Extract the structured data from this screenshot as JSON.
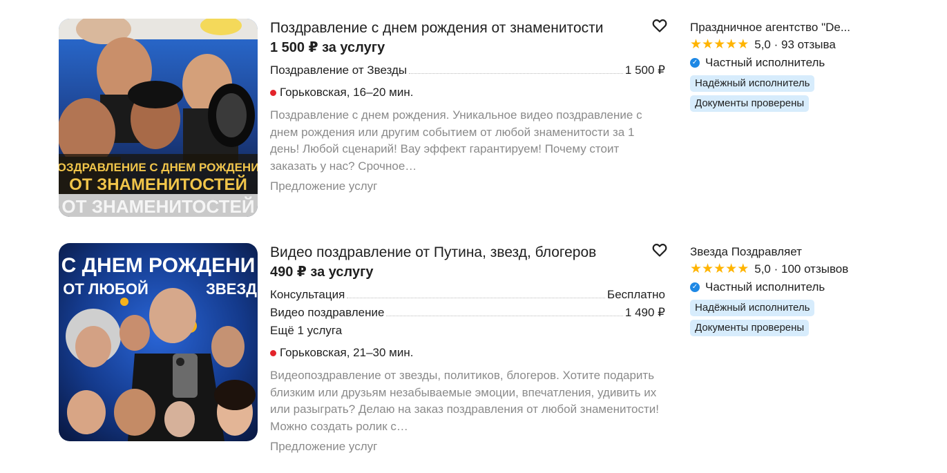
{
  "listings": [
    {
      "title": "Поздравление с днем рождения от знаменитости",
      "price": "1 500 ₽ за услугу",
      "services": [
        {
          "name": "Поздравление от Звезды",
          "price": "1 500 ₽"
        }
      ],
      "more_services": "",
      "location": "Горьковская, 16–20 мин.",
      "description": "Поздравление с днем рождения. Уникальное видео поздравление с днем рождения или другим событием от любой знаменитости за 1 день! Любой сценарий! Вау эффект гарантируем! Почему стоит заказать у нас? Срочное…",
      "category": "Предложение услуг",
      "image_text": {
        "line1": "ПОЗДРАВЛЕНИЕ С ДНЕМ РОЖДЕНИЯ",
        "line2": "ОТ ЗНАМЕНИТОСТЕЙ",
        "line3": "ОТ ЗНАМЕНИТОСТЕЙ"
      },
      "seller": {
        "name": "Праздничное агентство \"De...",
        "rating": "5,0",
        "reviews": "· 93 отзыва",
        "type": "Частный исполнитель",
        "badges": [
          "Надёжный исполнитель",
          "Документы проверены"
        ]
      }
    },
    {
      "title": "Видео поздравление от Путина, звезд, блогеров",
      "price": "490 ₽ за услугу",
      "services": [
        {
          "name": "Консультация",
          "price": "Бесплатно"
        },
        {
          "name": "Видео поздравление",
          "price": "1 490 ₽"
        }
      ],
      "more_services": "Ещё 1 услуга",
      "location": "Горьковская, 21–30 мин.",
      "description": "Видеопоздравление от звезды, политиков, блогеров. Хотите подарить близким или друзьям незабываемые эмоции, впечатления, удивить их или разыграть? Делаю на заказ поздравления от любой знаменитости! Можно создать ролик с…",
      "category": "Предложение услуг",
      "image_text": {
        "line1": "С ДНЕМ РОЖДЕНИ",
        "line2": "ОТ ЛЮБОЙ",
        "line3": "ЗВЕЗД"
      },
      "seller": {
        "name": "Звезда Поздравляет",
        "rating": "5,0",
        "reviews": "· 100 отзывов",
        "type": "Частный исполнитель",
        "badges": [
          "Надёжный исполнитель",
          "Документы проверены"
        ]
      }
    }
  ],
  "colors": {
    "star": "#ffb400",
    "metro": "#e3242b",
    "badge_bg": "#d7ecfc",
    "verified": "#1e88e5",
    "muted": "#8a8a8a"
  },
  "icons": {
    "favorite": "heart-outline-icon",
    "star": "star-icon",
    "verified": "check-circle-icon",
    "metro": "metro-dot-icon"
  }
}
